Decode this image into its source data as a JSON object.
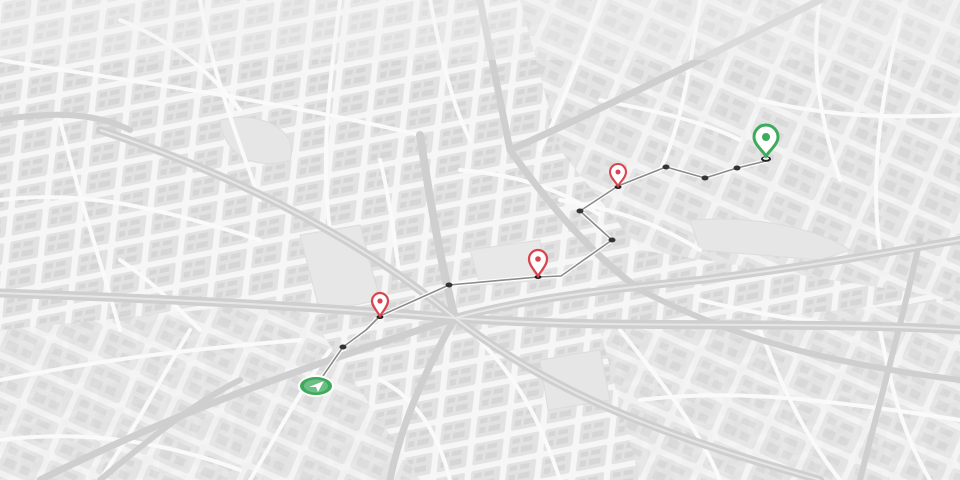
{
  "map": {
    "style": "light-grey-isometric-city",
    "colors": {
      "background": "#ececec",
      "block": "#e3e3e3",
      "building": "#d7d7d7",
      "street_minor": "#f7f7f7",
      "street_major": "#d2d2d2",
      "route_line": "#8a8a8a",
      "route_casing": "#ffffff",
      "waypoint_dot": "#333333",
      "stop_pin": "#d9444f",
      "destination_pin": "#3daa5c",
      "start_marker": "#3daa5c"
    }
  },
  "route": {
    "start_marker": {
      "kind": "start",
      "icon": "navigation-arrow-icon"
    },
    "stops": [
      {
        "kind": "stop",
        "icon": "map-pin-icon"
      },
      {
        "kind": "stop",
        "icon": "map-pin-icon"
      },
      {
        "kind": "stop",
        "icon": "map-pin-icon"
      }
    ],
    "destination": {
      "kind": "destination",
      "icon": "map-pin-icon"
    }
  }
}
